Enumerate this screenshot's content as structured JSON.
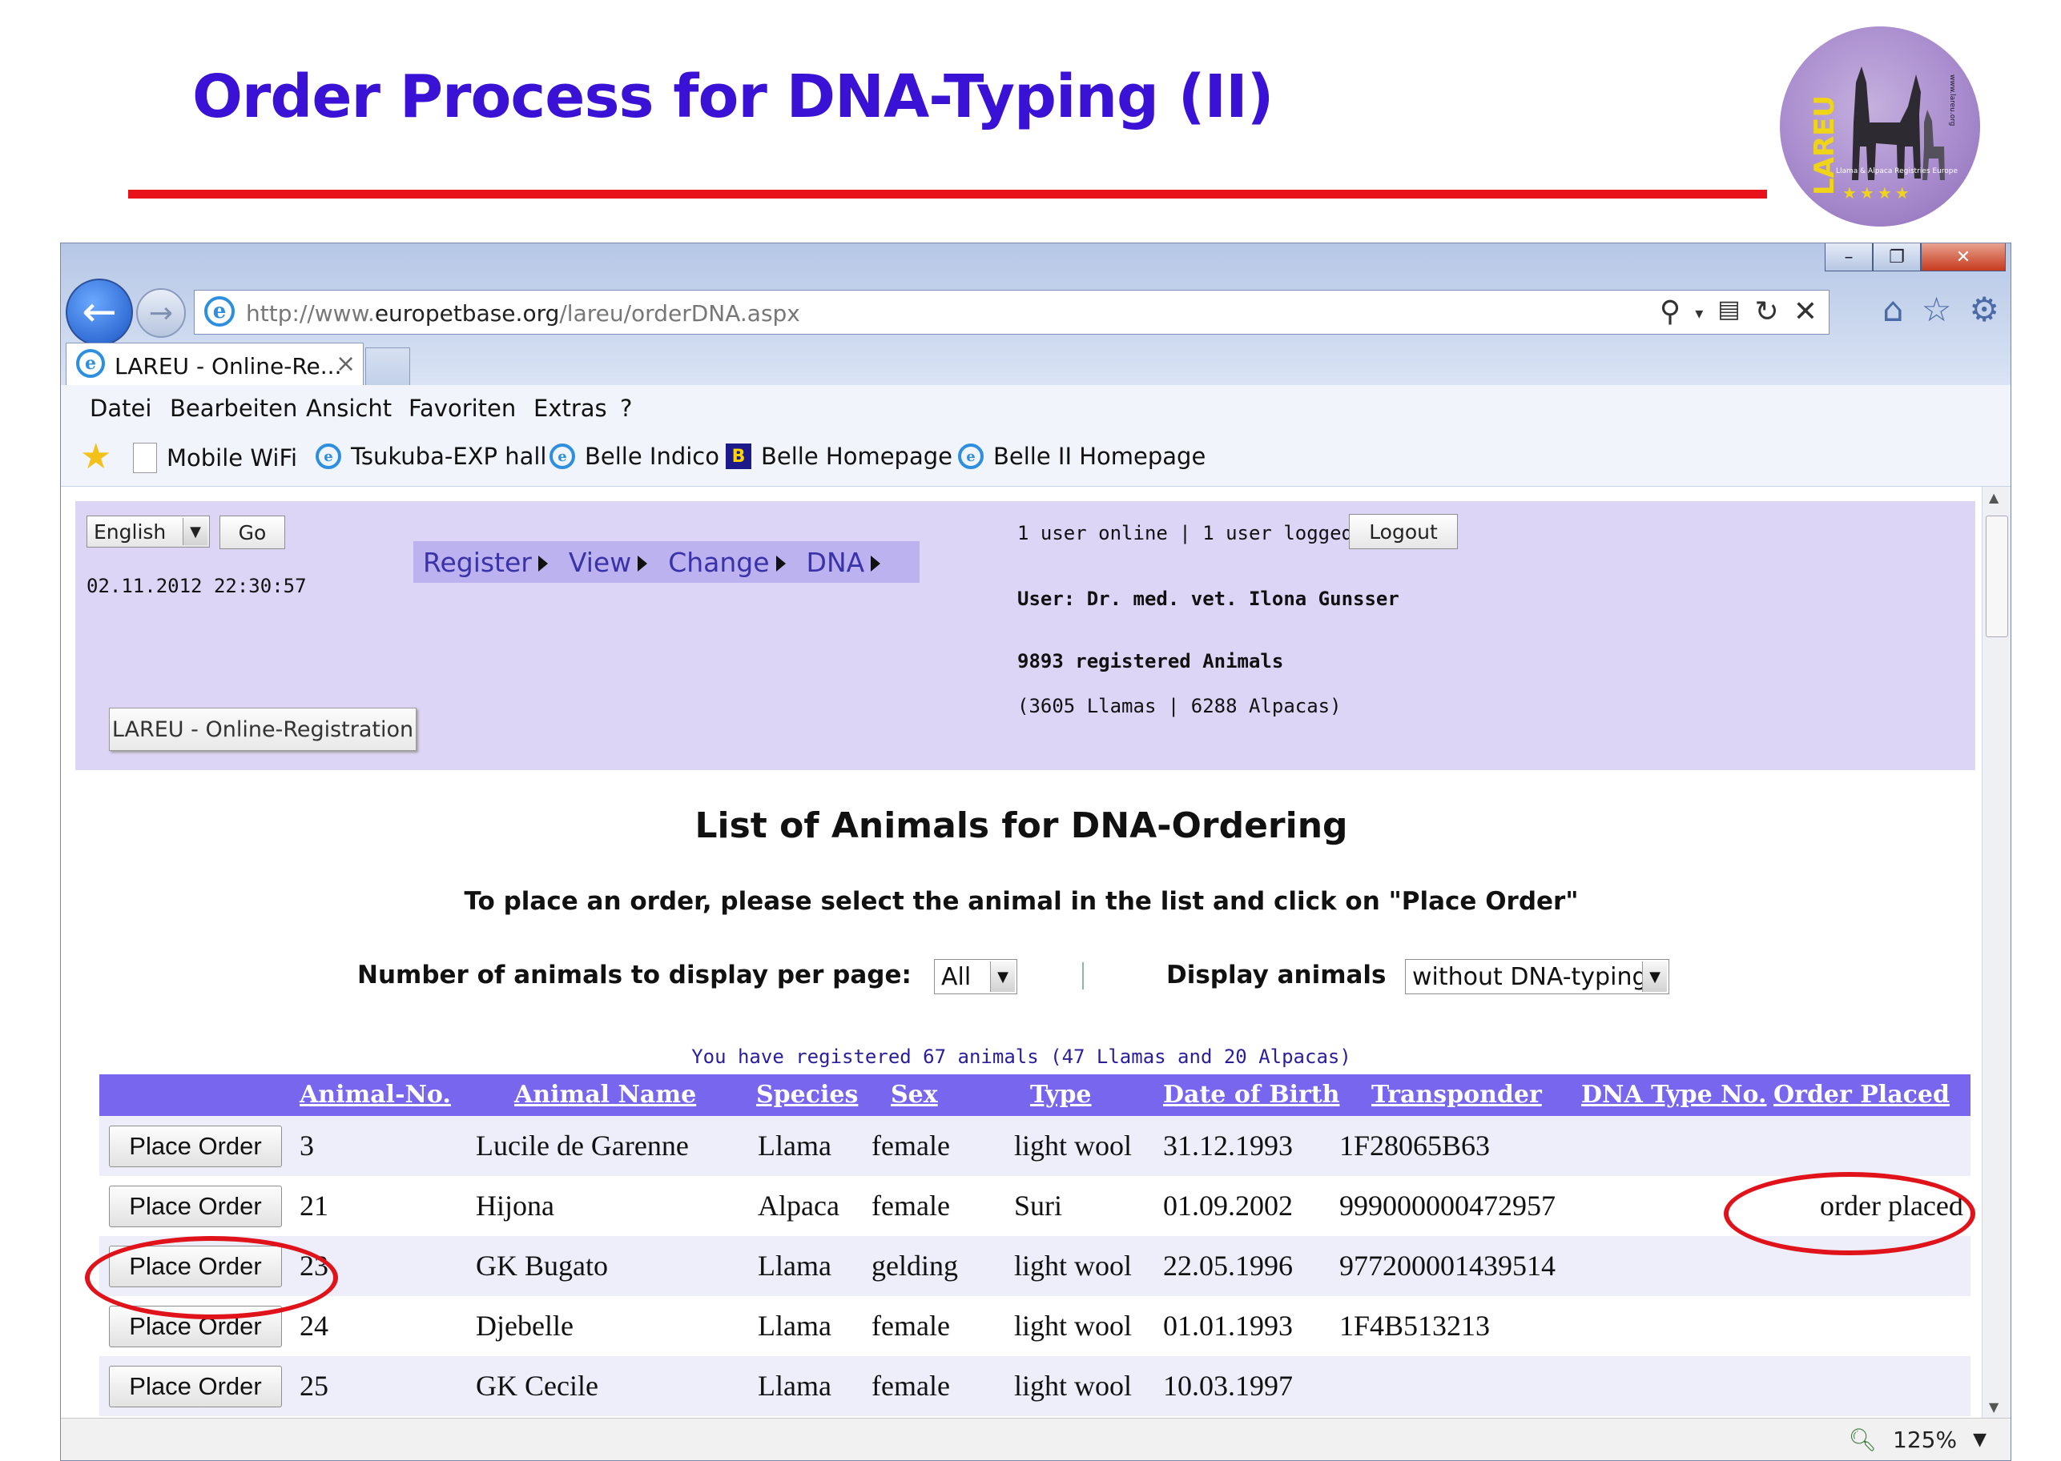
{
  "slide": {
    "title": "Order Process for DNA-Typing (II)"
  },
  "logo": {
    "text": "LAREU",
    "subtitle": "Llama & Alpaca Registries Europe",
    "site": "www.lareu.org"
  },
  "browser": {
    "url_prefix": "http://www.",
    "url_domain": "europetbase.org",
    "url_path": "/lareu/orderDNA.aspx",
    "tab_title": "LAREU - Online-Re...",
    "tab_close": "×",
    "menu": [
      "Datei",
      "Bearbeiten",
      "Ansicht",
      "Favoriten",
      "Extras",
      "?"
    ],
    "favorites": [
      "Mobile WiFi",
      "Tsukuba-EXP hall",
      "Belle Indico",
      "Belle Homepage",
      "Belle II Homepage"
    ],
    "zoom": "125%"
  },
  "header": {
    "language": "English",
    "go_label": "Go",
    "datetime": "02.11.2012 22:30:57",
    "menu": [
      "Register",
      "View",
      "Change",
      "DNA"
    ],
    "registration_button": "LAREU - Online-Registration",
    "status": "1 user online | 1 user logged in",
    "logout_label": "Logout",
    "user": "User: Dr. med. vet. Ilona Gunsser",
    "registered": "9893 registered Animals",
    "breakdown": "(3605 Llamas | 6288 Alpacas)"
  },
  "main": {
    "title": "List of Animals for DNA-Ordering",
    "instruction": "To place an order, please select the animal in the list and click on \"Place Order\"",
    "per_page_label": "Number of animals to display per page:",
    "per_page_value": "All",
    "display_label": "Display animals",
    "display_value": "without DNA-typing",
    "registered_info": "You have registered 67 animals (47 Llamas and 20 Alpacas)"
  },
  "table": {
    "columns": [
      "Animal-No.",
      "Animal Name",
      "Species",
      "Sex",
      "Type",
      "Date of Birth",
      "Transponder",
      "DNA Type No.",
      "Order Placed"
    ],
    "button_label": "Place Order",
    "rows": [
      {
        "no": "3",
        "name": "Lucile de Garenne",
        "species": "Llama",
        "sex": "female",
        "type": "light wool",
        "dob": "31.12.1993",
        "transponder": "1F28065B63",
        "dna": "",
        "order": ""
      },
      {
        "no": "21",
        "name": "Hijona",
        "species": "Alpaca",
        "sex": "female",
        "type": "Suri",
        "dob": "01.09.2002",
        "transponder": "999000000472957",
        "dna": "",
        "order": "order placed"
      },
      {
        "no": "23",
        "name": "GK Bugato",
        "species": "Llama",
        "sex": "gelding",
        "type": "light wool",
        "dob": "22.05.1996",
        "transponder": "977200001439514",
        "dna": "",
        "order": ""
      },
      {
        "no": "24",
        "name": "Djebelle",
        "species": "Llama",
        "sex": "female",
        "type": "light wool",
        "dob": "01.01.1993",
        "transponder": "1F4B513213",
        "dna": "",
        "order": ""
      },
      {
        "no": "25",
        "name": "GK Cecile",
        "species": "Llama",
        "sex": "female",
        "type": "light wool",
        "dob": "10.03.1997",
        "transponder": "",
        "dna": "",
        "order": ""
      }
    ]
  },
  "colors": {
    "title": "#3a12d6",
    "accent_red": "#e8121a",
    "panel": "#ddd5f5",
    "table_header": "#7866ee",
    "info_text": "#2a1e9c"
  }
}
